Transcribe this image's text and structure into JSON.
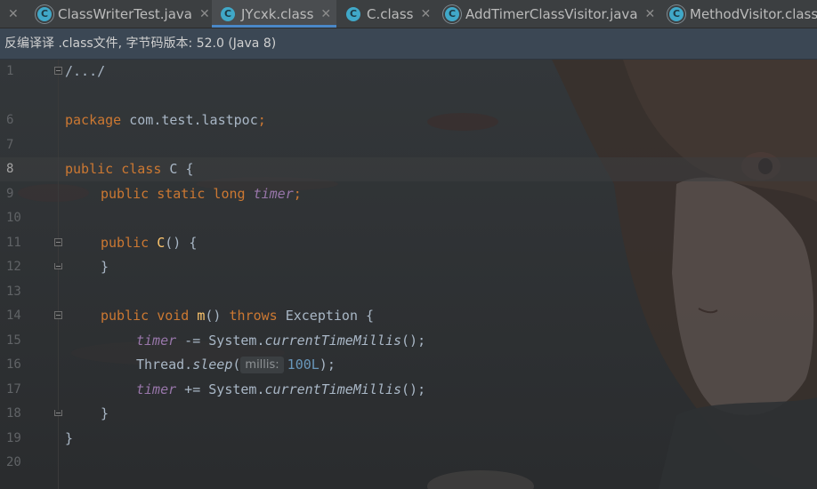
{
  "tabs": [
    {
      "label": "ClassWriterTest.java",
      "icon": "java-class-icon",
      "active": false
    },
    {
      "label": "JYcxk.class",
      "icon": "class-file-icon",
      "active": true
    },
    {
      "label": "C.class",
      "icon": "class-file-icon",
      "active": false
    },
    {
      "label": "AddTimerClassVisitor.java",
      "icon": "java-class-icon",
      "active": false
    },
    {
      "label": "MethodVisitor.class",
      "icon": "class-file-icon",
      "active": false
    }
  ],
  "banner": {
    "text": "反编译译 .class文件, 字节码版本: 52.0 (Java 8)"
  },
  "editor": {
    "current_line": 8,
    "lines": [
      {
        "no": "1"
      },
      {
        "no": "6"
      },
      {
        "no": "7"
      },
      {
        "no": "8"
      },
      {
        "no": "9"
      },
      {
        "no": "10"
      },
      {
        "no": "11"
      },
      {
        "no": "12"
      },
      {
        "no": "13"
      },
      {
        "no": "14"
      },
      {
        "no": "15"
      },
      {
        "no": "16"
      },
      {
        "no": "17"
      },
      {
        "no": "18"
      },
      {
        "no": "19"
      },
      {
        "no": "20"
      }
    ],
    "code": {
      "l1_comment": "/.../",
      "l6_package_kw": "package",
      "l6_package_name": " com.test.lastpoc",
      "l6_semicolon": ";",
      "l8_public": "public",
      "l8_class": "class",
      "l8_name": "C",
      "l8_brace": " {",
      "l9_mods": "public static long",
      "l9_field": "timer",
      "l9_semicolon": ";",
      "l11_public": "public",
      "l11_ctor": "C",
      "l11_rest": "() {",
      "l12_brace": "}",
      "l14_mods": "public void",
      "l14_method": "m",
      "l14_paren": "() ",
      "l14_throws": "throws",
      "l14_exc": " Exception {",
      "l15_field": "timer",
      "l15_op": " -= System.",
      "l15_call": "currentTimeMillis",
      "l15_end": "();",
      "l16_thread": "Thread.",
      "l16_sleep": "sleep",
      "l16_open": "(",
      "l16_hint": "millis:",
      "l16_num": "100L",
      "l16_end": ");",
      "l17_field": "timer",
      "l17_op": " += System.",
      "l17_call": "currentTimeMillis",
      "l17_end": "();",
      "l18_brace": "}",
      "l19_brace": "}"
    }
  },
  "colors": {
    "keyword": "#cc7832",
    "field": "#9876aa",
    "method_decl": "#ffc66d",
    "number": "#6897bb",
    "accent": "#4a88c7"
  }
}
